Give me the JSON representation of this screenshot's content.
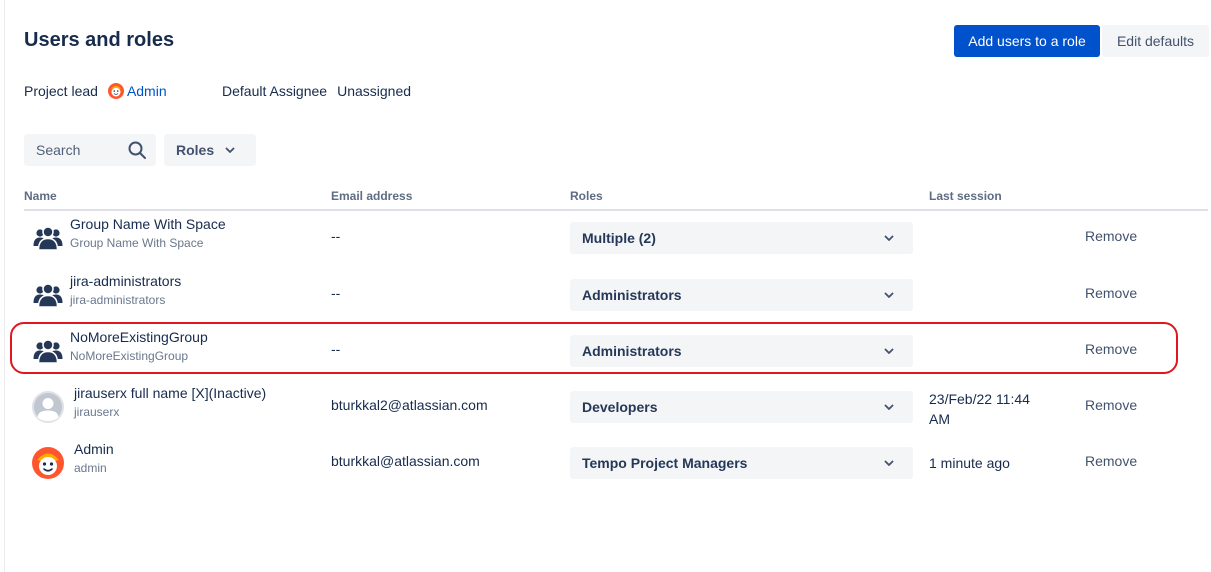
{
  "header": {
    "title": "Users and roles",
    "add_users_label": "Add users to a role",
    "edit_defaults_label": "Edit defaults"
  },
  "meta": {
    "project_lead_label": "Project lead",
    "project_lead_value": "Admin",
    "default_assignee_label": "Default Assignee",
    "default_assignee_value": "Unassigned"
  },
  "filters": {
    "search_placeholder": "Search",
    "roles_label": "Roles"
  },
  "table": {
    "columns": [
      "Name",
      "Email address",
      "Roles",
      "Last session"
    ],
    "rows": [
      {
        "type": "group",
        "name": "Group Name With Space",
        "subname": "Group Name With Space",
        "email": "--",
        "role": "Multiple (2)",
        "last_session": "",
        "action": "Remove"
      },
      {
        "type": "group",
        "name": "jira-administrators",
        "subname": "jira-administrators",
        "email": "--",
        "role": "Administrators",
        "last_session": "",
        "action": "Remove"
      },
      {
        "type": "group",
        "name": "NoMoreExistingGroup",
        "subname": "NoMoreExistingGroup",
        "email": "--",
        "role": "Administrators",
        "last_session": "",
        "action": "Remove"
      },
      {
        "type": "user-inactive",
        "name": "jirauserx full name [X](Inactive)",
        "subname": "jirauserx",
        "email": "bturkkal2@atlassian.com",
        "role": "Developers",
        "last_session": "23/Feb/22 11:44 AM",
        "action": "Remove"
      },
      {
        "type": "user-admin",
        "name": "Admin",
        "subname": "admin",
        "email": "bturkkal@atlassian.com",
        "role": "Tempo Project Managers",
        "last_session": "1 minute ago",
        "action": "Remove"
      }
    ]
  },
  "colors": {
    "primary": "#0052cc",
    "highlight": "#e0171f",
    "text": "#172b4d"
  },
  "icons": {
    "group": "group-icon",
    "user_default": "default-user-avatar",
    "admin": "admin-avatar",
    "search": "search-icon",
    "chevron": "chevron-down-icon"
  }
}
